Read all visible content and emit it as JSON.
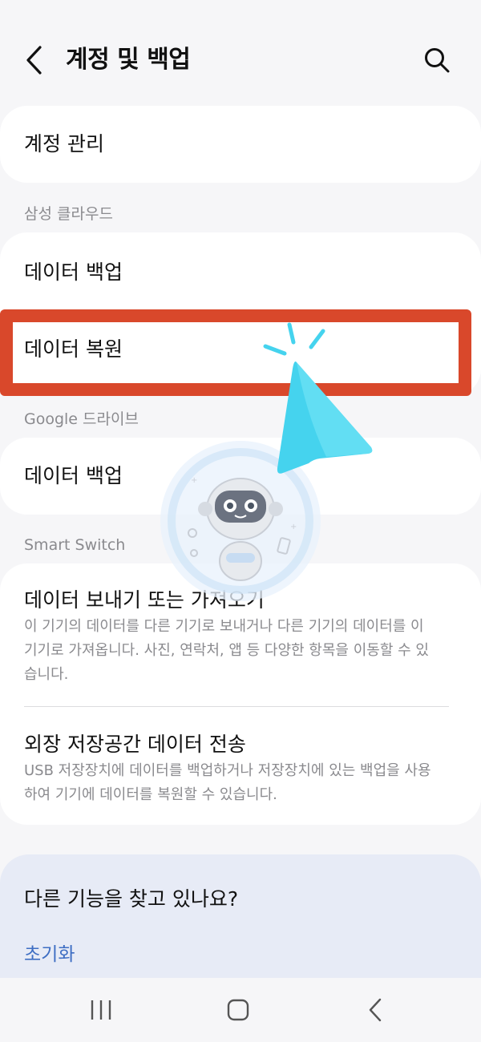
{
  "header": {
    "title": "계정 및 백업"
  },
  "account": {
    "manage_label": "계정 관리"
  },
  "samsung_cloud": {
    "section_label": "삼성 클라우드",
    "backup_label": "데이터 백업",
    "restore_label": "데이터 복원"
  },
  "google_drive": {
    "section_label": "Google 드라이브",
    "backup_label": "데이터 백업"
  },
  "smart_switch": {
    "section_label": "Smart Switch",
    "transfer_title": "데이터 보내기 또는 가져오기",
    "transfer_desc": "이 기기의 데이터를 다른 기기로 보내거나 다른 기기의 데이터를 이 기기로 가져옵니다. 사진, 연락처, 앱 등 다양한 항목을 이동할 수 있습니다.",
    "external_title": "외장 저장공간 데이터 전송",
    "external_desc": "USB 저장장치에 데이터를 백업하거나 저장장치에 있는 백업을 사용하여 기기에 데이터를 복원할 수 있습니다."
  },
  "help": {
    "title": "다른 기능을 찾고 있나요?",
    "reset_link": "초기화"
  },
  "icons": {
    "back": "chevron-left-icon",
    "search": "search-icon",
    "recents": "recents-icon",
    "home": "home-icon",
    "nav_back": "nav-back-icon"
  },
  "colors": {
    "highlight": "#d9482b",
    "pointer": "#45d3ee",
    "link": "#3e6ec3",
    "help_card": "#e7ebf6"
  }
}
